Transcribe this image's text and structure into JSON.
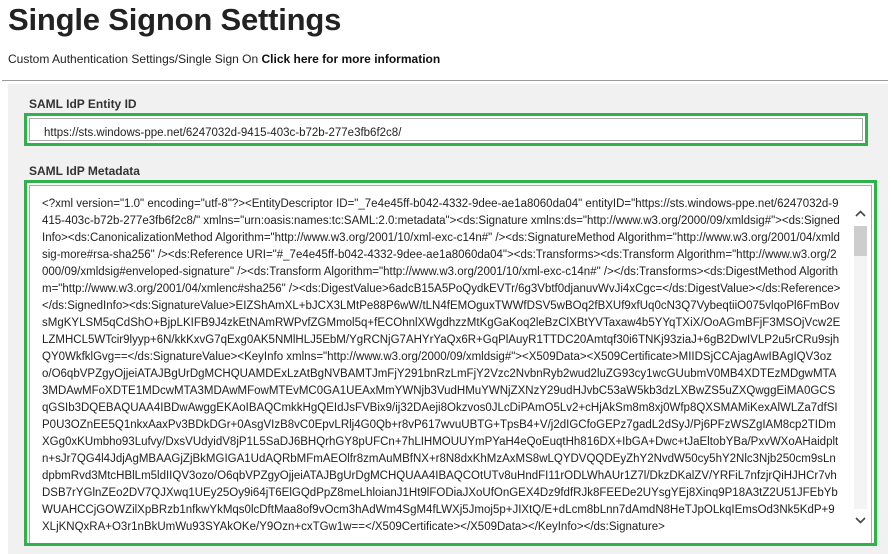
{
  "header": {
    "title": "Single Signon Settings",
    "subtitle_text": "Custom Authentication Settings/Single Sign On ",
    "more_info_link": "Click here for more information"
  },
  "entity_id": {
    "label": "SAML IdP Entity ID",
    "value": "https://sts.windows-ppe.net/6247032d-9415-403c-b72b-277e3fb6f2c8/"
  },
  "metadata": {
    "label": "SAML IdP Metadata",
    "value": "<?xml version=\"1.0\" encoding=\"utf-8\"?><EntityDescriptor ID=\"_7e4e45ff-b042-4332-9dee-ae1a8060da04\" entityID=\"https://sts.windows-ppe.net/6247032d-9415-403c-b72b-277e3fb6f2c8/\" xmlns=\"urn:oasis:names:tc:SAML:2.0:metadata\"><ds:Signature xmlns:ds=\"http://www.w3.org/2000/09/xmldsig#\"><ds:SignedInfo><ds:CanonicalizationMethod Algorithm=\"http://www.w3.org/2001/10/xml-exc-c14n#\" /><ds:SignatureMethod Algorithm=\"http://www.w3.org/2001/04/xmldsig-more#rsa-sha256\" /><ds:Reference URI=\"#_7e4e45ff-b042-4332-9dee-ae1a8060da04\"><ds:Transforms><ds:Transform Algorithm=\"http://www.w3.org/2000/09/xmldsig#enveloped-signature\" /><ds:Transform Algorithm=\"http://www.w3.org/2001/10/xml-exc-c14n#\" /></ds:Transforms><ds:DigestMethod Algorithm=\"http://www.w3.org/2001/04/xmlenc#sha256\" /><ds:DigestValue>6adcB15A5PoQydkEVTr/6g3Vbtf0djanuvWvJi4xCgc=</ds:DigestValue></ds:Reference></ds:SignedInfo><ds:SignatureValue>EIZShAmXL+bJCX3LMtPe88P6wW/tLN4fEMOguxTWWfDSV5wBOq2fBXUf9xfUq0cN3Q7VybeqtiiO075vlqoPl6FmBovsMgKYLSM5qCdShO+BjpLKIFB9J4zkEtNAmRWPvfZGMmol5q+fECOhnlXWgdhzzMtKgGaKoq2leBzClXBtYVTaxaw4b5YYqTXiX/OoAGmBFjF3MSOjVcw2ELZMHCL5WTcir9lyyp+6N/kkKxvG7qExg0AK5NMlHLJ5EbM/YgRCNjG7AHYrYaQx6R+GqPlAuyR1TTDC20Amtqf30i6TNKj93ziaJ+6gB2DwIVLP2u5rCRu9sjhQY0WkfklGvg==</ds:SignatureValue><KeyInfo xmlns=\"http://www.w3.org/2000/09/xmldsig#\"><X509Data><X509Certificate>MIIDSjCCAjagAwIBAgIQV3ozo/O6qbVPZgyOjjeiATAJBgUrDgMCHQUAMDExLzAtBgNVBAMTJmFjY291bnRzLmFjY2Vzc2NvbnRyb2wud2luZG93cy1wcGUubmV0MB4XDTEzMDgwMTA3MDAwMFoXDTE1MDcwMTA3MDAwMFowMTEvMC0GA1UEAxMmYWNjb3VudHMuYWNjZXNzY29udHJvbC53aW5kb3dzLXBwZS5uZXQwggEiMA0GCSqGSIb3DQEBAQUAA4IBDwAwggEKAoIBAQCmkkHgQEIdJsFVBix9/ij32DAeji8Okzvos0JLcDiPAmO5Lv2+cHjAkSm8m8xj0Wfp8QXSMAMiKexAlWLZa7dfSIP0U3OZnEE5Q1nkxAaxPv3BDkDGr+0AsgVIzB8vC0EpvLRlj4G0Qb+r8vP617wvuUBTG+TpsB4+V/j2dIGCfoGEPz7gadL2dSyJ/Pj6PFzWSZgIAM8cp2TIDmXGg0xKUmbho93Lufvy/DxsVUdyidV8jP1L5SaDJ6BHQrhGY8pUFCn+7hLIHMOUUYmPYaH4eQoEuqtHh816DX+IbGA+Dwc+tJaEltobYBa/PxvWXoAHaidpltn+sJr7QG4l4JdjAgMBAAGjZjBkMGIGA1UdAQRbMFmAEOlfr8zmAuMBfNX+r8N8dxKhMzAxMS8wLQYDVQQDEyZhY2NvdW50cy5hY2Nlc3Njb250cm9sLndpbmRvd3MtcHBlLm5ldIIQV3ozo/O6qbVPZgyOjjeiATAJBgUrDgMCHQUAA4IBAQCOtUTv8uHndFI11rODLWhAUr1Z7l/DkzDKalZV/YRFiL7nfzjrQiHJHCr7vhDSB7rYGlnZEo2DV7QJXwq1UEy25Oy9i64jT6ElGQdPpZ8meLhloianJ1Ht9lFODiaJXoUfOnGEX4Dz9fdfRJk8FEEDe2UYsgYEj8Xinq9P18A3tZ2U51JFEbYbWUAHCCjGOWZilXpBRzb1nfkwYkMqs0lcDftMaa8of9vOcm3hAdWm4SgM4fLWXj5Jmoj5p+JIXtQ/E+dLcm8bLnn7dAmdN8HeTJpOLkqIEmsOd3Nk5KdP+9XLjKNQxRA+O3r1nBkUmWu93SYAkOKe/Y9Ozn+cxTGw1w==</X509Certificate></X509Data></KeyInfo></ds:Signature>"
  },
  "icons": {
    "scroll_up": "chevron-up-icon",
    "scroll_down": "chevron-down-icon"
  },
  "colors": {
    "highlight_border": "#2db34a",
    "panel_background": "#f1f1f1"
  }
}
